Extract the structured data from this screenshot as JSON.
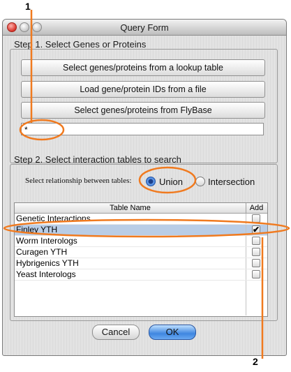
{
  "callouts": {
    "one": "1",
    "two": "2"
  },
  "window": {
    "title": "Query Form"
  },
  "step1": {
    "title": "Step 1. Select Genes or Proteins",
    "buttons": [
      "Select genes/proteins from a lookup table",
      "Load gene/protein IDs from a file",
      "Select genes/proteins from FlyBase"
    ],
    "input_value": "*"
  },
  "step2": {
    "title": "Step 2. Select interaction tables to search",
    "relationship_label": "Select relationship between tables:",
    "options": {
      "union": "Union",
      "intersection": "Intersection"
    },
    "selected": "union",
    "table": {
      "headers": {
        "name": "Table Name",
        "add": "Add"
      },
      "rows": [
        {
          "name": "Genetic Interactions",
          "checked": false
        },
        {
          "name": "Finley YTH",
          "checked": true
        },
        {
          "name": "Worm Interologs",
          "checked": false
        },
        {
          "name": "Curagen YTH",
          "checked": false
        },
        {
          "name": "Hybrigenics YTH",
          "checked": false
        },
        {
          "name": "Yeast Interologs",
          "checked": false
        }
      ]
    }
  },
  "footer": {
    "cancel": "Cancel",
    "ok": "OK"
  },
  "annotation_color": "#f07a1f",
  "check_mark": "✔"
}
